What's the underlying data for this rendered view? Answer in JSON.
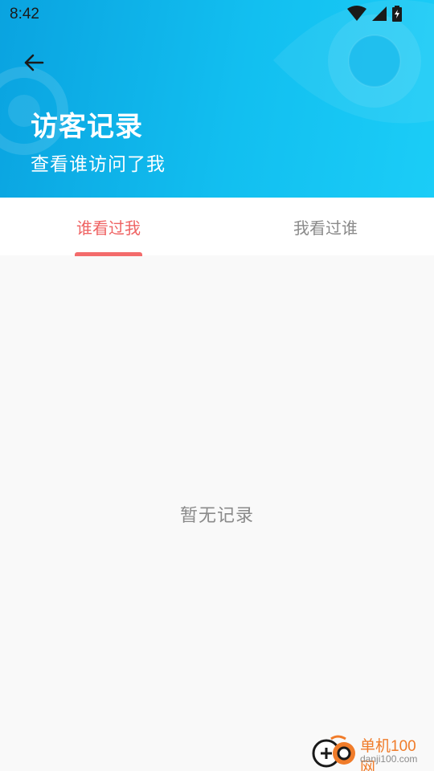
{
  "status_bar": {
    "time": "8:42",
    "icons": [
      "wifi-icon",
      "cellular-signal-icon",
      "battery-charging-icon"
    ]
  },
  "header": {
    "back_icon": "arrow-left-icon",
    "title": "访客记录",
    "subtitle": "查看谁访问了我",
    "gradient_colors": [
      "#0aa3e0",
      "#1bcdf7"
    ]
  },
  "tabs": [
    {
      "label": "谁看过我",
      "active": true
    },
    {
      "label": "我看过谁",
      "active": false
    }
  ],
  "empty_state": {
    "text": "暂无记录"
  },
  "watermark": {
    "brand": "单机100网",
    "url": "danji100.com"
  },
  "colors": {
    "accent": "#f36b6b",
    "inactive_tab": "#8a8a8a",
    "background": "#f9f9f9"
  }
}
